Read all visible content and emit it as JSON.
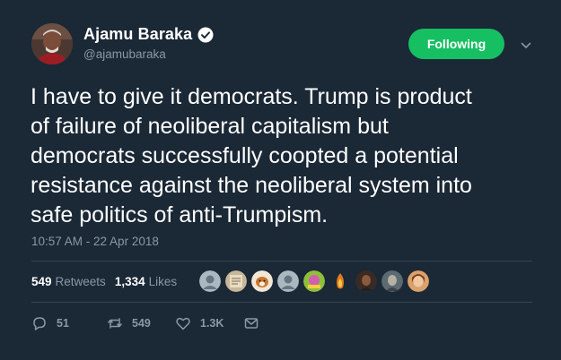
{
  "author": {
    "display_name": "Ajamu Baraka",
    "handle": "@ajamubaraka",
    "verified": true
  },
  "follow_button": {
    "label": "Following"
  },
  "tweet": {
    "text": "I have to give it democrats. Trump is product\nof failure of neoliberal capitalism but\ndemocrats successfully coopted a potential\nresistance against the neoliberal system into\nsafe politics of anti-Trumpism.",
    "timestamp": "10:57 AM - 22 Apr 2018"
  },
  "stats": {
    "retweets_count": "549",
    "retweets_label": "Retweets",
    "likes_count": "1,334",
    "likes_label": "Likes"
  },
  "actions": {
    "reply_count": "51",
    "retweet_count": "549",
    "like_count": "1.3K"
  },
  "colors": {
    "background": "#1b2836",
    "following_button": "#17bf63",
    "secondary_text": "#8899a6",
    "divider": "#38444d"
  },
  "liker_avatars": [
    "avatar-1",
    "avatar-2",
    "avatar-3",
    "avatar-4",
    "avatar-5",
    "avatar-6",
    "avatar-7",
    "avatar-8",
    "avatar-9",
    "avatar-10"
  ]
}
